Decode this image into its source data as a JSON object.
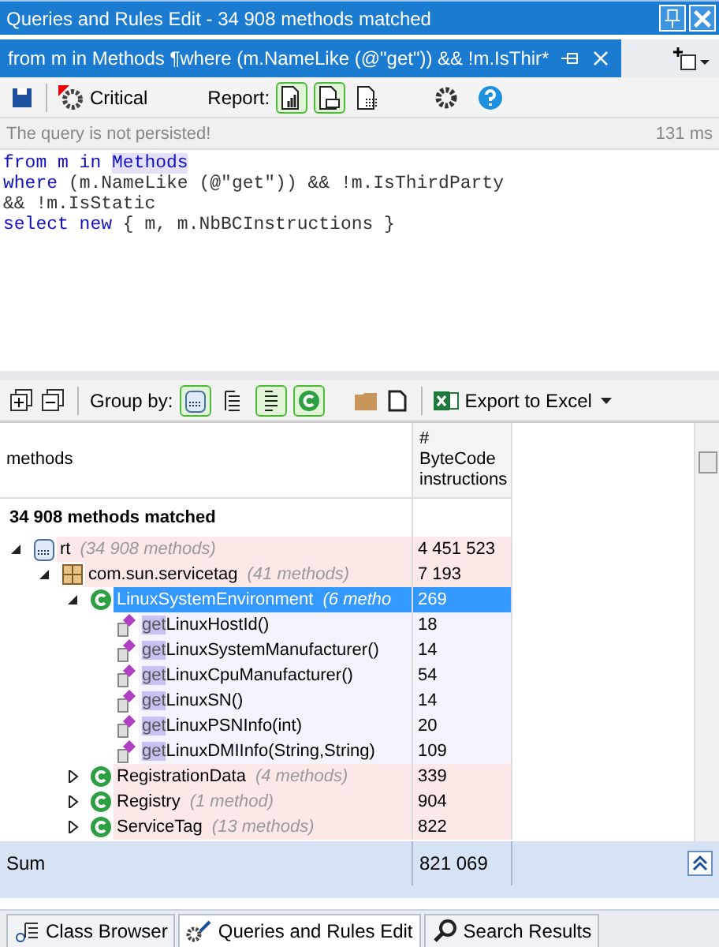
{
  "window": {
    "title": "Queries and Rules Edit  - 34 908 methods matched"
  },
  "doc_tab": {
    "label": "from m in Methods ¶where (m.NameLike (@\"get\")) && !m.IsThir*",
    "selected": true
  },
  "toolbar": {
    "critical_label": "Critical",
    "report_label": "Report:",
    "report_buttons": [
      {
        "on": true
      },
      {
        "on": true
      },
      {
        "on": false
      }
    ]
  },
  "status": {
    "message": "The query is not persisted!",
    "duration": "131 ms"
  },
  "code_lines": [
    [
      {
        "kind": "keyword",
        "text": "from m in "
      },
      {
        "kind": "type",
        "text": "Methods"
      }
    ],
    [
      {
        "kind": "keyword",
        "text": "where "
      },
      {
        "kind": "plain",
        "text": "(m.NameLike (@\"get\")) && !m.IsThirdParty"
      }
    ],
    [
      {
        "kind": "plain",
        "text": "&& !m.IsStatic"
      }
    ],
    [
      {
        "kind": "keyword",
        "text": "select new "
      },
      {
        "kind": "plain",
        "text": "{ m, m.NbBCInstructions }"
      }
    ]
  ],
  "results_toolbar": {
    "group_by_label": "Group by:",
    "group_buttons": [
      {
        "on": true
      },
      {
        "on": false
      },
      {
        "on": true
      },
      {
        "on": true
      }
    ],
    "export_label": "Export to Excel"
  },
  "table": {
    "columns": [
      "methods",
      "#\nByteCode\ninstructions"
    ],
    "summary": "34 908 methods matched",
    "rows": [
      {
        "kind": "assembly",
        "name": "rt",
        "count": "(34 908 methods)",
        "value": "4 451 523",
        "expanded": true,
        "selected": false,
        "children": [
          {
            "kind": "namespace",
            "name": "com.sun.servicetag",
            "count": "(41 methods)",
            "value": "7 193",
            "expanded": true,
            "selected": false,
            "children": [
              {
                "kind": "class",
                "name": "LinuxSystemEnvironment",
                "count": "(6 metho",
                "value": "269",
                "expanded": true,
                "selected": true,
                "children": [
                  {
                    "kind": "method",
                    "match": "get",
                    "name": "LinuxHostId()",
                    "value": "18",
                    "selected": false
                  },
                  {
                    "kind": "method",
                    "match": "get",
                    "name": "LinuxSystemManufacturer()",
                    "value": "14",
                    "selected": false
                  },
                  {
                    "kind": "method",
                    "match": "get",
                    "name": "LinuxCpuManufacturer()",
                    "value": "54",
                    "selected": false
                  },
                  {
                    "kind": "method",
                    "match": "get",
                    "name": "LinuxSN()",
                    "value": "14",
                    "selected": false
                  },
                  {
                    "kind": "method",
                    "match": "get",
                    "name": "LinuxPSNInfo(int)",
                    "value": "20",
                    "selected": false
                  },
                  {
                    "kind": "method",
                    "match": "get",
                    "name": "LinuxDMIInfo(String,String)",
                    "value": "109",
                    "selected": false
                  }
                ]
              },
              {
                "kind": "class",
                "name": "RegistrationData",
                "count": "(4 methods)",
                "value": "339",
                "expanded": false,
                "selected": false
              },
              {
                "kind": "class",
                "name": "Registry",
                "count": "(1 method)",
                "value": "904",
                "expanded": false,
                "selected": false
              },
              {
                "kind": "class",
                "name": "ServiceTag",
                "count": "(13 methods)",
                "value": "822",
                "expanded": false,
                "selected": false
              }
            ]
          }
        ]
      }
    ],
    "sum_label": "Sum",
    "sum_value": "821 069"
  },
  "bottom_tabs": [
    {
      "label": "Class Browser",
      "selected": false
    },
    {
      "label": "Queries and Rules Edit",
      "selected": true
    },
    {
      "label": "Search Results",
      "selected": false
    }
  ]
}
